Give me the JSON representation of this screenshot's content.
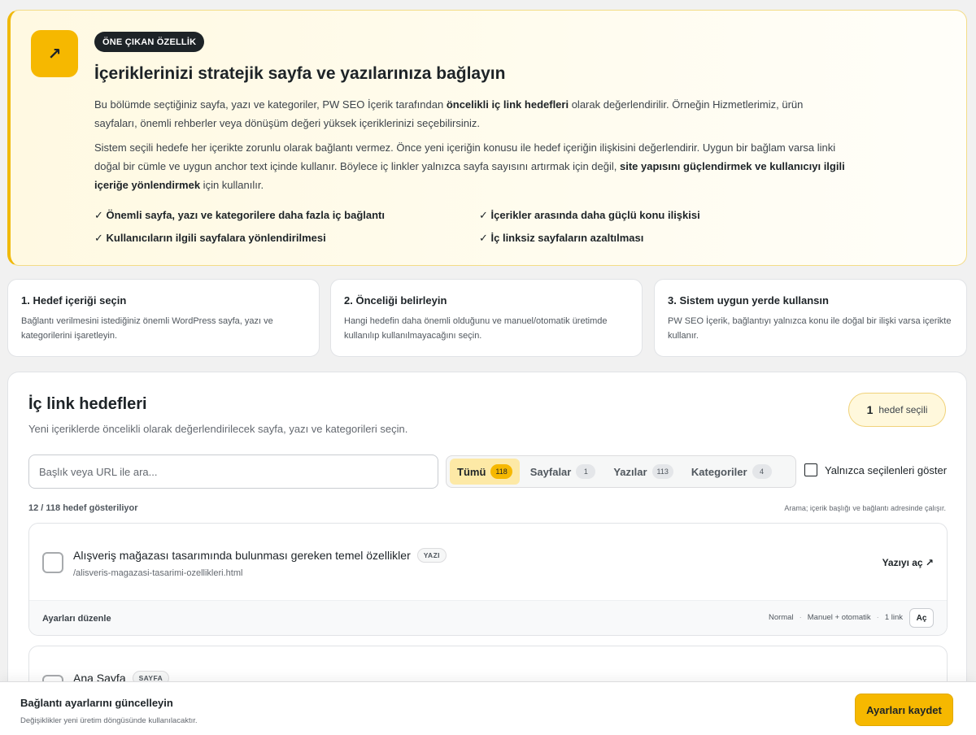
{
  "hero": {
    "icon": "arrow-up-right-icon",
    "icon_glyph": "↗",
    "badge": "ÖNE ÇIKAN ÖZELLİK",
    "title": "İçeriklerinizi stratejik sayfa ve yazılarınıza bağlayın",
    "p1_a": "Bu bölümde seçtiğiniz sayfa, yazı ve kategoriler, PW SEO İçerik tarafından ",
    "p1_b": "öncelikli iç link hedefleri",
    "p1_c": " olarak değerlendirilir. Örneğin Hizmetlerimiz, ürün sayfaları, önemli rehberler veya dönüşüm değeri yüksek içeriklerinizi seçebilirsiniz.",
    "p2_a": "Sistem seçili hedefe her içerikte zorunlu olarak bağlantı vermez. Önce yeni içeriğin konusu ile hedef içeriğin ilişkisini değerlendirir. Uygun bir bağlam varsa linki doğal bir cümle ve uygun anchor text içinde kullanır. Böylece iç linkler yalnızca sayfa sayısını artırmak için değil, ",
    "p2_b": "site yapısını güçlendirmek ve kullanıcıyı ilgili içeriğe yönlendirmek",
    "p2_c": " için kullanılır.",
    "benefits": [
      "✓ Önemli sayfa, yazı ve kategorilere daha fazla iç bağlantı",
      "✓ İçerikler arasında daha güçlü konu ilişkisi",
      "✓ Kullanıcıların ilgili sayfalara yönlendirilmesi",
      "✓ İç linksiz sayfaların azaltılması"
    ]
  },
  "steps": [
    {
      "title": "1. Hedef içeriği seçin",
      "desc": "Bağlantı verilmesini istediğiniz önemli WordPress sayfa, yazı ve kategorilerini işaretleyin."
    },
    {
      "title": "2. Önceliği belirleyin",
      "desc": "Hangi hedefin daha önemli olduğunu ve manuel/otomatik üretimde kullanılıp kullanılmayacağını seçin."
    },
    {
      "title": "3. Sistem uygun yerde kullansın",
      "desc": "PW SEO İçerik, bağlantıyı yalnızca konu ile doğal bir ilişki varsa içerikte kullanır."
    }
  ],
  "panel": {
    "title": "İç link hedefleri",
    "subtitle": "Yeni içeriklerde öncelikli olarak değerlendirilecek sayfa, yazı ve kategorileri seçin.",
    "selected_count": "1",
    "selected_label": "hedef seçili",
    "search_placeholder": "Başlık veya URL ile ara...",
    "filters": [
      {
        "label": "Tümü",
        "count": "118"
      },
      {
        "label": "Sayfalar",
        "count": "1"
      },
      {
        "label": "Yazılar",
        "count": "113"
      },
      {
        "label": "Kategoriler",
        "count": "4"
      }
    ],
    "only_selected": "Yalnızca seçilenleri göster",
    "count_line": "12 / 118 hedef gösteriliyor",
    "search_hint": "Arama; içerik başlığı ve bağlantı adresinde çalışır.",
    "items": [
      {
        "title": "Alışveriş mağazası tasarımında bulunması gereken temel özellikler",
        "type": "YAZI",
        "url": "/alisveris-magazasi-tasarimi-ozellikleri.html",
        "open": "Yazıyı aç ↗",
        "foot_label": "Ayarları düzenle",
        "priority": "Normal",
        "mode": "Manuel + otomatik",
        "links": "1 link",
        "foot_open": "Aç"
      },
      {
        "title": "Ana Sayfa",
        "type": "SAYFA"
      }
    ]
  },
  "savebar": {
    "title": "Bağlantı ayarlarını güncelleyin",
    "subtitle": "Değişiklikler yeni üretim döngüsünde kullanılacaktır.",
    "button": "Ayarları kaydet"
  }
}
